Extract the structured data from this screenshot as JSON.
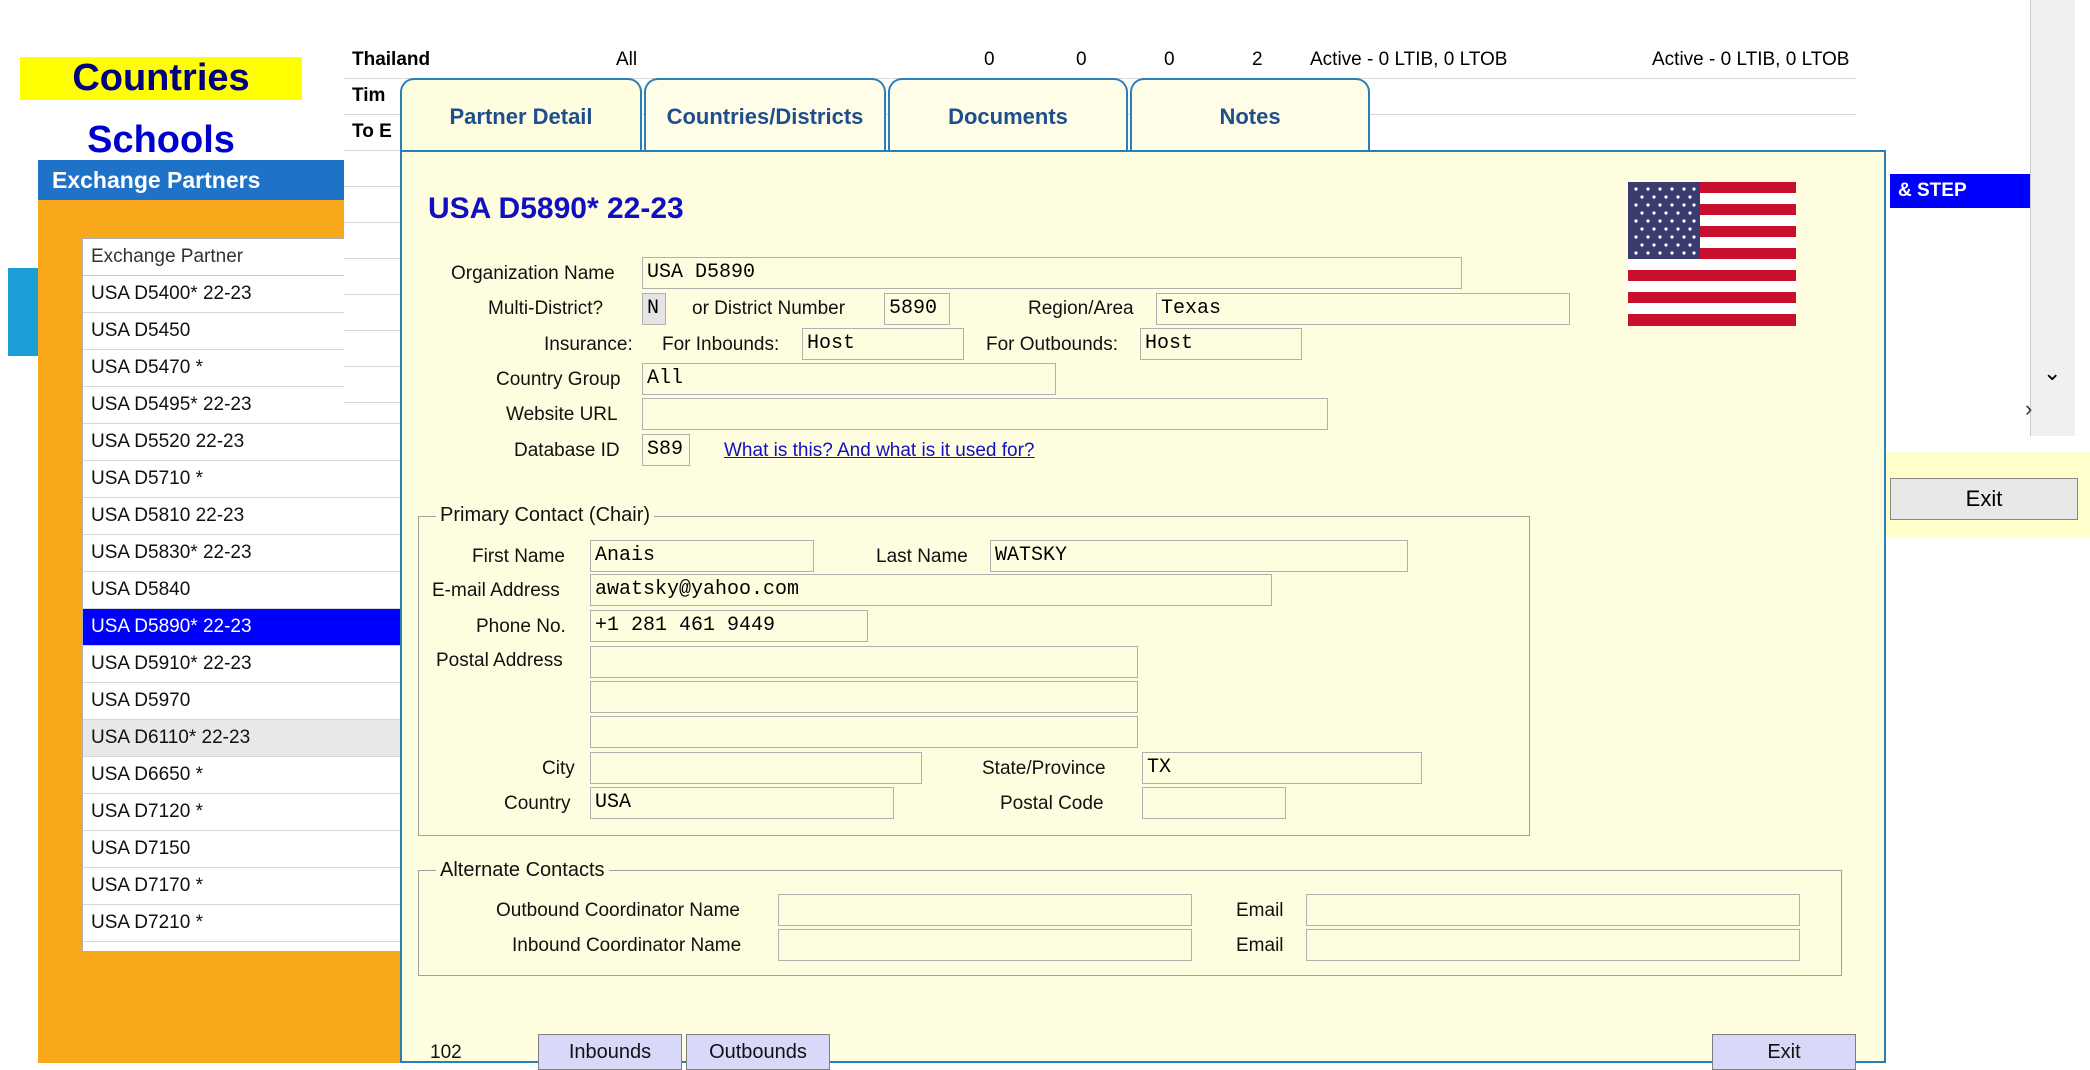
{
  "left_nav": {
    "countries": "Countries",
    "schools": "Schools"
  },
  "exchange_partners": {
    "title": "Exchange Partners",
    "column_header": "Exchange Partner",
    "rows": [
      "USA D5400* 22-23",
      "USA D5450",
      "USA D5470 *",
      "USA D5495* 22-23",
      "USA D5520 22-23",
      "USA D5710 *",
      "USA D5810 22-23",
      "USA D5830* 22-23",
      "USA D5840",
      "USA D5890* 22-23",
      "USA D5910* 22-23",
      "USA D5970",
      "USA D6110* 22-23",
      "USA D6650 *",
      "USA D7120 *",
      "USA D7150",
      "USA D7170 *",
      "USA D7210 *"
    ],
    "selected": "USA D5890* 22-23"
  },
  "background_grid": {
    "row0": {
      "country": "Thailand",
      "group": "All",
      "c1": "0",
      "c2": "0",
      "c3": "0",
      "c4": "2",
      "status1": "Active - 0 LTIB, 0 LTOB",
      "status2": "Active - 0 LTIB, 0 LTOB"
    },
    "row1": {
      "country": "Tim"
    },
    "row2": {
      "country": "To E"
    },
    "highlight": "& STEP",
    "exit": "Exit"
  },
  "tabs": [
    {
      "label": "Partner Detail"
    },
    {
      "label": "Countries/Districts"
    },
    {
      "label": "Documents"
    },
    {
      "label": "Notes"
    }
  ],
  "partner": {
    "title": "USA D5890* 22-23",
    "labels": {
      "org_name": "Organization Name",
      "multi_district": "Multi-District?",
      "district_number": "or District Number",
      "region": "Region/Area",
      "insurance": "Insurance:",
      "for_inbounds": "For Inbounds:",
      "for_outbounds": "For Outbounds:",
      "country_group": "Country Group",
      "website": "Website URL",
      "database_id": "Database ID"
    },
    "org_name": "USA D5890",
    "multi_district": "N",
    "district_number": "5890",
    "region": "Texas",
    "insurance_inbound": "Host",
    "insurance_outbound": "Host",
    "country_group": "All",
    "website": "",
    "database_id": "S89",
    "database_link": "What is this? And what is it used for?"
  },
  "primary_contact": {
    "title": "Primary Contact (Chair)",
    "labels": {
      "first_name": "First Name",
      "last_name": "Last Name",
      "email": "E-mail Address",
      "phone": "Phone No.",
      "postal_address": "Postal Address",
      "city": "City",
      "state": "State/Province",
      "country": "Country",
      "postal_code": "Postal Code"
    },
    "first_name": "Anais",
    "last_name": "WATSKY",
    "email": "awatsky@yahoo.com",
    "phone": "+1 281 461 9449",
    "address1": "",
    "address2": "",
    "address3": "",
    "city": "",
    "state": "TX",
    "country": "USA",
    "postal_code": ""
  },
  "alternate_contacts": {
    "title": "Alternate Contacts",
    "labels": {
      "outbound": "Outbound Coordinator Name",
      "inbound": "Inbound Coordinator Name",
      "email": "Email"
    },
    "outbound_name": "",
    "outbound_email": "",
    "inbound_name": "",
    "inbound_email": ""
  },
  "footer": {
    "count": "102",
    "inbounds": "Inbounds",
    "outbounds": "Outbounds",
    "exit": "Exit"
  },
  "colors": {
    "accent_blue": "#1010c0",
    "selection": "#0000ff",
    "dialog_bg": "#fffde0",
    "panel_orange": "#f9a81c",
    "nav_yellow": "#ffff00"
  }
}
